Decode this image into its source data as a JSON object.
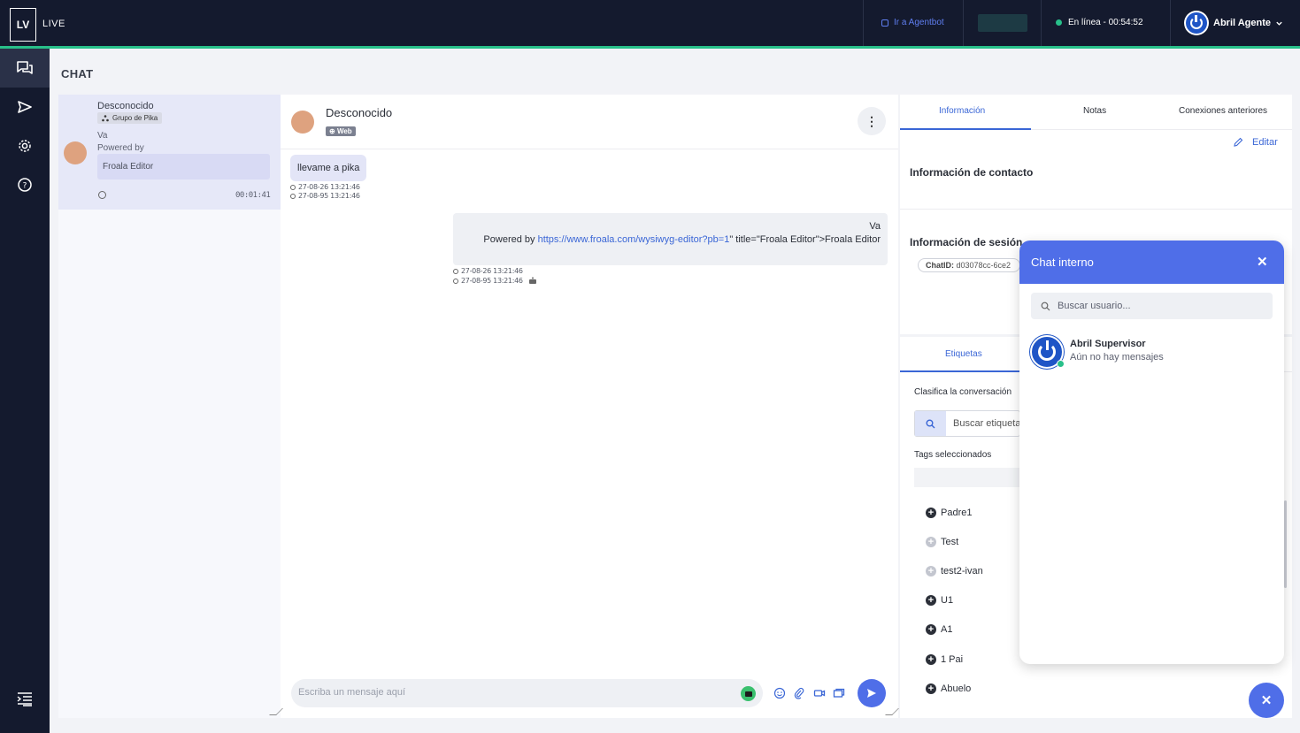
{
  "header": {
    "logo": "LV",
    "app_name": "LIVE",
    "agentbot_link": "Ir a Agentbot",
    "status_text": "En línea - 00:54:52",
    "user_name": "Abril Agente"
  },
  "page": {
    "title": "CHAT"
  },
  "conversation_list": {
    "items": [
      {
        "name": "Desconocido",
        "group": "Grupo de Pika",
        "preview_line1": "Va",
        "preview_line2": "Powered by",
        "preview_quote": "Froala Editor",
        "time": "00:01:41"
      }
    ]
  },
  "chat": {
    "contact_name": "Desconocido",
    "channel_badge": "Web",
    "messages": [
      {
        "direction": "in",
        "text": "llevame a pika",
        "timestamp1": "27-08-26 13:21:46",
        "timestamp2": "27-08-95 13:21:46"
      },
      {
        "direction": "out",
        "line1": "Va",
        "line2_prefix": "Powered by ",
        "link": "https://www.froala.com/wysiwyg-editor?pb=1",
        "line2_suffix": "\" title=\"Froala Editor\">Froala Editor",
        "timestamp1": "27-08-26 13:21:46",
        "timestamp2": "27-08-95 13:21:46"
      }
    ],
    "composer_placeholder": "Escriba un mensaje aquí"
  },
  "info": {
    "tabs": [
      "Información",
      "Notas",
      "Conexiones anteriores"
    ],
    "edit_label": "Editar",
    "contact_section": "Información de contacto",
    "session_section": "Información de sesión",
    "chat_id_label": "ChatID:",
    "chat_id_value": "d03078cc-6ce2"
  },
  "tags": {
    "tab": "Etiquetas",
    "classify_text": "Clasifica la conversación",
    "search_placeholder": "Buscar etiqueta",
    "selected_label": "Tags seleccionados",
    "items": [
      {
        "label": "Padre1",
        "enabled": true
      },
      {
        "label": "Test",
        "enabled": false
      },
      {
        "label": "test2-ivan",
        "enabled": false
      },
      {
        "label": "U1",
        "enabled": true
      },
      {
        "label": "A1",
        "enabled": true
      },
      {
        "label": "1 Pai",
        "enabled": true
      },
      {
        "label": "Abuelo",
        "enabled": true
      }
    ]
  },
  "internal_chat": {
    "title": "Chat interno",
    "search_placeholder": "Buscar usuario...",
    "users": [
      {
        "name": "Abril Supervisor",
        "subtitle": "Aún no hay mensajes"
      }
    ]
  },
  "colors": {
    "nav_bg": "#141a2e",
    "accent_green": "#28c08a",
    "primary_blue": "#4f6ee8",
    "link_blue": "#3a66d6"
  }
}
